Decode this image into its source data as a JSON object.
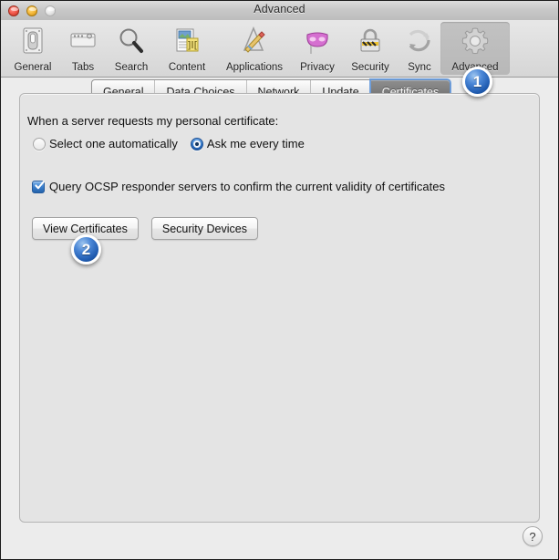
{
  "window": {
    "title": "Advanced",
    "traffic_lights": [
      {
        "name": "close",
        "color": "#f2594c"
      },
      {
        "name": "minimize",
        "color": "#f7bb3d"
      },
      {
        "name": "zoom",
        "color": "#e8e8e8"
      }
    ]
  },
  "toolbar": {
    "items": [
      {
        "label": "General",
        "icon": "general-switch-icon",
        "selected": false
      },
      {
        "label": "Tabs",
        "icon": "tabs-icon",
        "selected": false
      },
      {
        "label": "Search",
        "icon": "search-magnifier-icon",
        "selected": false
      },
      {
        "label": "Content",
        "icon": "content-document-icon",
        "selected": false
      },
      {
        "label": "Applications",
        "icon": "applications-icon",
        "selected": false
      },
      {
        "label": "Privacy",
        "icon": "privacy-mask-icon",
        "selected": false
      },
      {
        "label": "Security",
        "icon": "security-padlock-icon",
        "selected": false
      },
      {
        "label": "Sync",
        "icon": "sync-arrows-icon",
        "selected": false
      },
      {
        "label": "Advanced",
        "icon": "advanced-gear-icon",
        "selected": true
      }
    ]
  },
  "tabs": {
    "items": [
      {
        "label": "General",
        "selected": false
      },
      {
        "label": "Data Choices",
        "selected": false
      },
      {
        "label": "Network",
        "selected": false
      },
      {
        "label": "Update",
        "selected": false
      },
      {
        "label": "Certificates",
        "selected": true
      }
    ]
  },
  "panel": {
    "prompt_label": "When a server requests my personal certificate:",
    "radios": [
      {
        "label": "Select one automatically",
        "selected": false
      },
      {
        "label": "Ask me every time",
        "selected": true
      }
    ],
    "ocsp": {
      "label": "Query OCSP responder servers to confirm the current validity of certificates",
      "checked": true
    },
    "buttons": [
      {
        "label": "View Certificates"
      },
      {
        "label": "Security Devices"
      }
    ]
  },
  "help_button": {
    "label": "?"
  },
  "callouts": [
    {
      "label": "1",
      "color": "#2f6fc4",
      "target": "certificates-tab"
    },
    {
      "label": "2",
      "color": "#2f6fc4",
      "target": "view-certificates-button"
    }
  ]
}
